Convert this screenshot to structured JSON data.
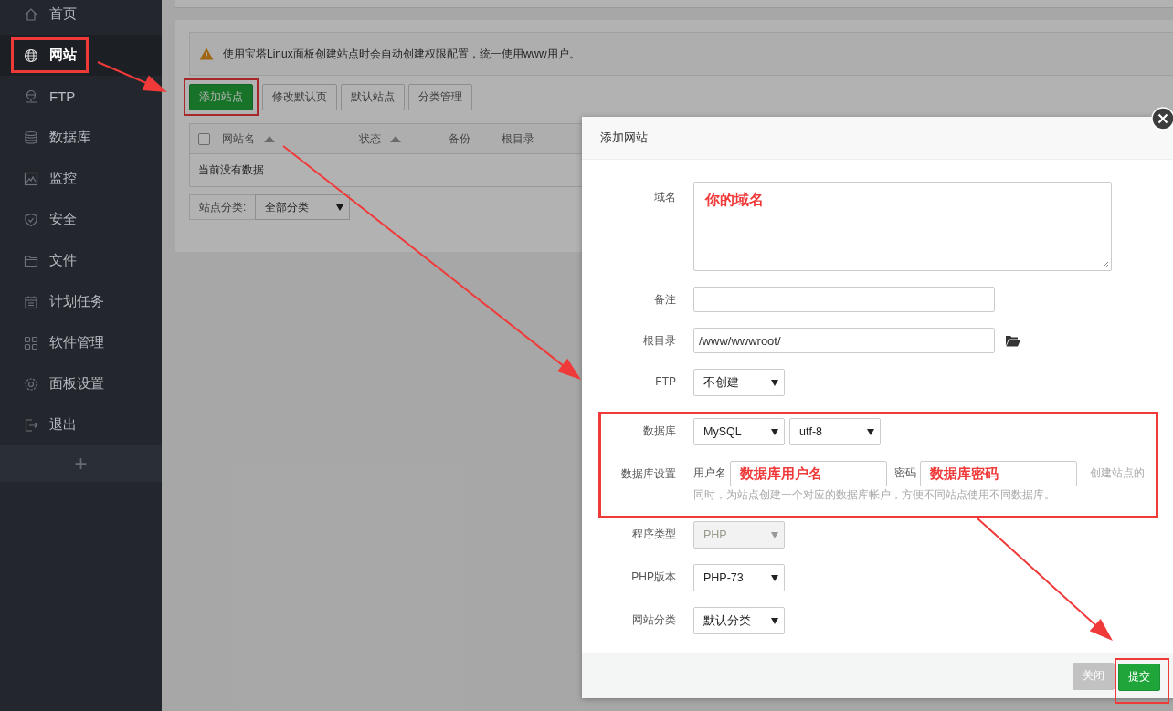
{
  "sidebar": {
    "items": [
      {
        "label": "首页",
        "selected": false,
        "highlighted": false
      },
      {
        "label": "网站",
        "selected": true,
        "highlighted": true
      },
      {
        "label": "FTP",
        "selected": false,
        "highlighted": false
      },
      {
        "label": "数据库",
        "selected": false,
        "highlighted": false
      },
      {
        "label": "监控",
        "selected": false,
        "highlighted": false
      },
      {
        "label": "安全",
        "selected": false,
        "highlighted": false
      },
      {
        "label": "文件",
        "selected": false,
        "highlighted": false
      },
      {
        "label": "计划任务",
        "selected": false,
        "highlighted": false
      },
      {
        "label": "软件管理",
        "selected": false,
        "highlighted": false
      },
      {
        "label": "面板设置",
        "selected": false,
        "highlighted": false
      },
      {
        "label": "退出",
        "selected": false,
        "highlighted": false
      }
    ],
    "add_label": "+"
  },
  "notice": "使用宝塔Linux面板创建站点时会自动创建权限配置，统一使用www用户。",
  "toolbar": [
    {
      "label": "添加站点",
      "kind": "primary",
      "highlighted": true
    },
    {
      "label": "修改默认页",
      "kind": "default",
      "highlighted": false
    },
    {
      "label": "默认站点",
      "kind": "default",
      "highlighted": false
    },
    {
      "label": "分类管理",
      "kind": "default",
      "highlighted": false
    }
  ],
  "table": {
    "select_all_checked": false,
    "columns": [
      {
        "label": "网站名",
        "sortable": true
      },
      {
        "label": "状态",
        "sortable": true
      },
      {
        "label": "备份",
        "sortable": false
      },
      {
        "label": "根目录",
        "sortable": false
      }
    ],
    "empty_text": "当前没有数据"
  },
  "category_filter": {
    "label": "站点分类:",
    "value": "全部分类"
  },
  "dialog": {
    "title": "添加网站",
    "sections": [
      {
        "highlighted": false,
        "fields": [
          {
            "kind": "textarea",
            "label": "域名",
            "value": "你的域名",
            "annotated": true
          },
          {
            "kind": "text",
            "label": "备注"
          },
          {
            "kind": "path",
            "label": "根目录",
            "value": "/www/wwwroot/"
          },
          {
            "kind": "select",
            "label": "FTP",
            "values": [
              "不创建"
            ],
            "disabled": false
          }
        ]
      },
      {
        "highlighted": true,
        "fields": [
          {
            "kind": "select",
            "label": "数据库",
            "values": [
              "MySQL",
              "utf-8"
            ],
            "disabled": false
          },
          {
            "kind": "credentials",
            "label": "数据库设置",
            "user_label": "用户名",
            "user_value": "数据库用户名",
            "password_label": "密码",
            "password_value": "数据库密码",
            "annotated": true,
            "hint_lines": [
              "创建站点的",
              "同时，为站点创建一个对应的数据库帐户，方便不同站点使用不同数据库。"
            ]
          }
        ]
      },
      {
        "highlighted": false,
        "fields": [
          {
            "kind": "select",
            "label": "程序类型",
            "values": [
              "PHP"
            ],
            "disabled": true
          },
          {
            "kind": "select",
            "label": "PHP版本",
            "values": [
              "PHP-73"
            ],
            "disabled": false
          },
          {
            "kind": "select",
            "label": "网站分类",
            "values": [
              "默认分类"
            ],
            "disabled": false
          }
        ]
      }
    ],
    "buttons": [
      {
        "label": "关闭",
        "kind": "cancel",
        "highlighted": false
      },
      {
        "label": "提交",
        "kind": "submit",
        "highlighted": true
      }
    ]
  }
}
